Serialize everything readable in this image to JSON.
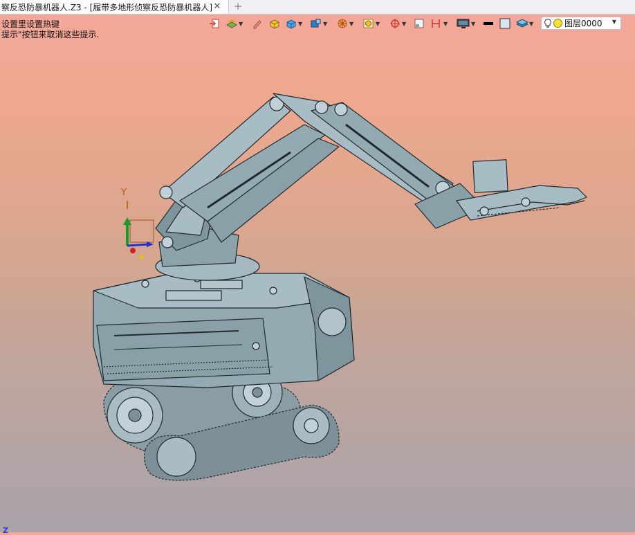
{
  "tab": {
    "title": "察反恐防暴机器人.Z3 - [履带多地形侦察反恐防暴机器人]",
    "close_glyph": "✕",
    "add_glyph": "+"
  },
  "hints": {
    "line1": "设置里设置热键",
    "line2": "提示\"按钮来取消这些提示."
  },
  "layer": {
    "value": "图层0000"
  },
  "axes": {
    "y": "Y",
    "z": "Z"
  },
  "colors": {
    "model": "#8fa6af",
    "model_edge": "#1f2a2f",
    "bg_top": "#f4a79a",
    "bg_bottom": "#a9a4ab"
  },
  "icons": [
    "exit-icon",
    "layer-group-icon",
    "pencil-icon",
    "solid-box-icon",
    "cube-icon",
    "view-cube-icon",
    "wheel-icon",
    "frame-icon",
    "crosshair-icon",
    "window-icon",
    "dimension-icon",
    "monitor-icon",
    "line-weight-icon",
    "color-swatch-icon",
    "layers-icon"
  ]
}
